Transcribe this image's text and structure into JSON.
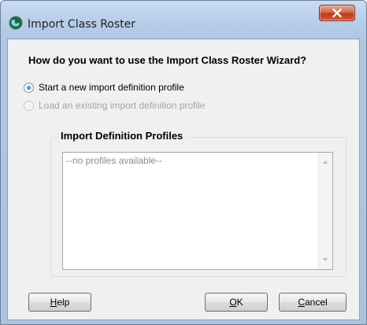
{
  "window": {
    "title": "Import Class Roster",
    "close_icon": "close-x-icon",
    "app_icon": "app-globe-icon"
  },
  "question": "How do you want to use the Import Class Roster Wizard?",
  "options": {
    "new_profile": {
      "label": "Start a new import definition profile",
      "checked": true,
      "enabled": true
    },
    "existing_profile": {
      "label": "Load an existing import definition profile",
      "checked": false,
      "enabled": false
    }
  },
  "profiles_group": {
    "label": "Import Definition Profiles",
    "empty_text": "--no profiles available--",
    "items": []
  },
  "buttons": {
    "help": {
      "mnemonic": "H",
      "rest": "elp"
    },
    "ok": {
      "mnemonic": "O",
      "rest": "K"
    },
    "cancel": {
      "mnemonic": "C",
      "rest": "ancel"
    }
  },
  "colors": {
    "titlebar": "#b9cfe9",
    "close_button": "#c0381b",
    "client_bg": "#f0f0f0",
    "disabled_text": "#a4a4a4"
  }
}
